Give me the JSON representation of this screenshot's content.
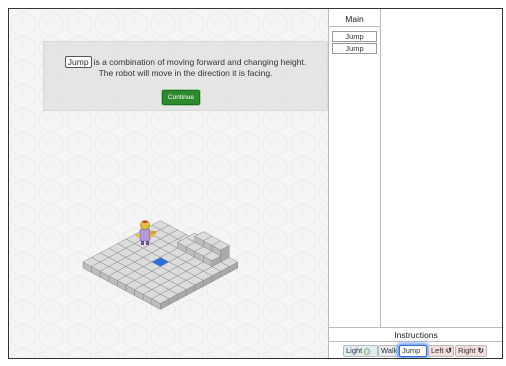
{
  "dialog": {
    "keyword": "Jump",
    "line1_rest": "is a combination of moving forward and changing height.",
    "line2": "The robot will move in the direction it is facing.",
    "continue_label": "Continue"
  },
  "main_panel": {
    "title": "Main",
    "items": [
      {
        "label": "Jump"
      },
      {
        "label": "Jump"
      }
    ]
  },
  "instructions": {
    "title": "Instructions",
    "buttons": [
      {
        "label": "Light",
        "icon": "bulb-icon"
      },
      {
        "label": "Walk"
      },
      {
        "label": "Jump",
        "selected": true
      },
      {
        "label": "Left",
        "icon": "rotate-left-icon",
        "glyph": "↺"
      },
      {
        "label": "Right",
        "icon": "rotate-right-icon",
        "glyph": "↻"
      }
    ]
  },
  "colors": {
    "continue_button": "#2e8a2e",
    "selected_highlight": "#6d9cf4",
    "target_tile": "#2f6fe0",
    "turn_buttons": "#f2dede"
  }
}
